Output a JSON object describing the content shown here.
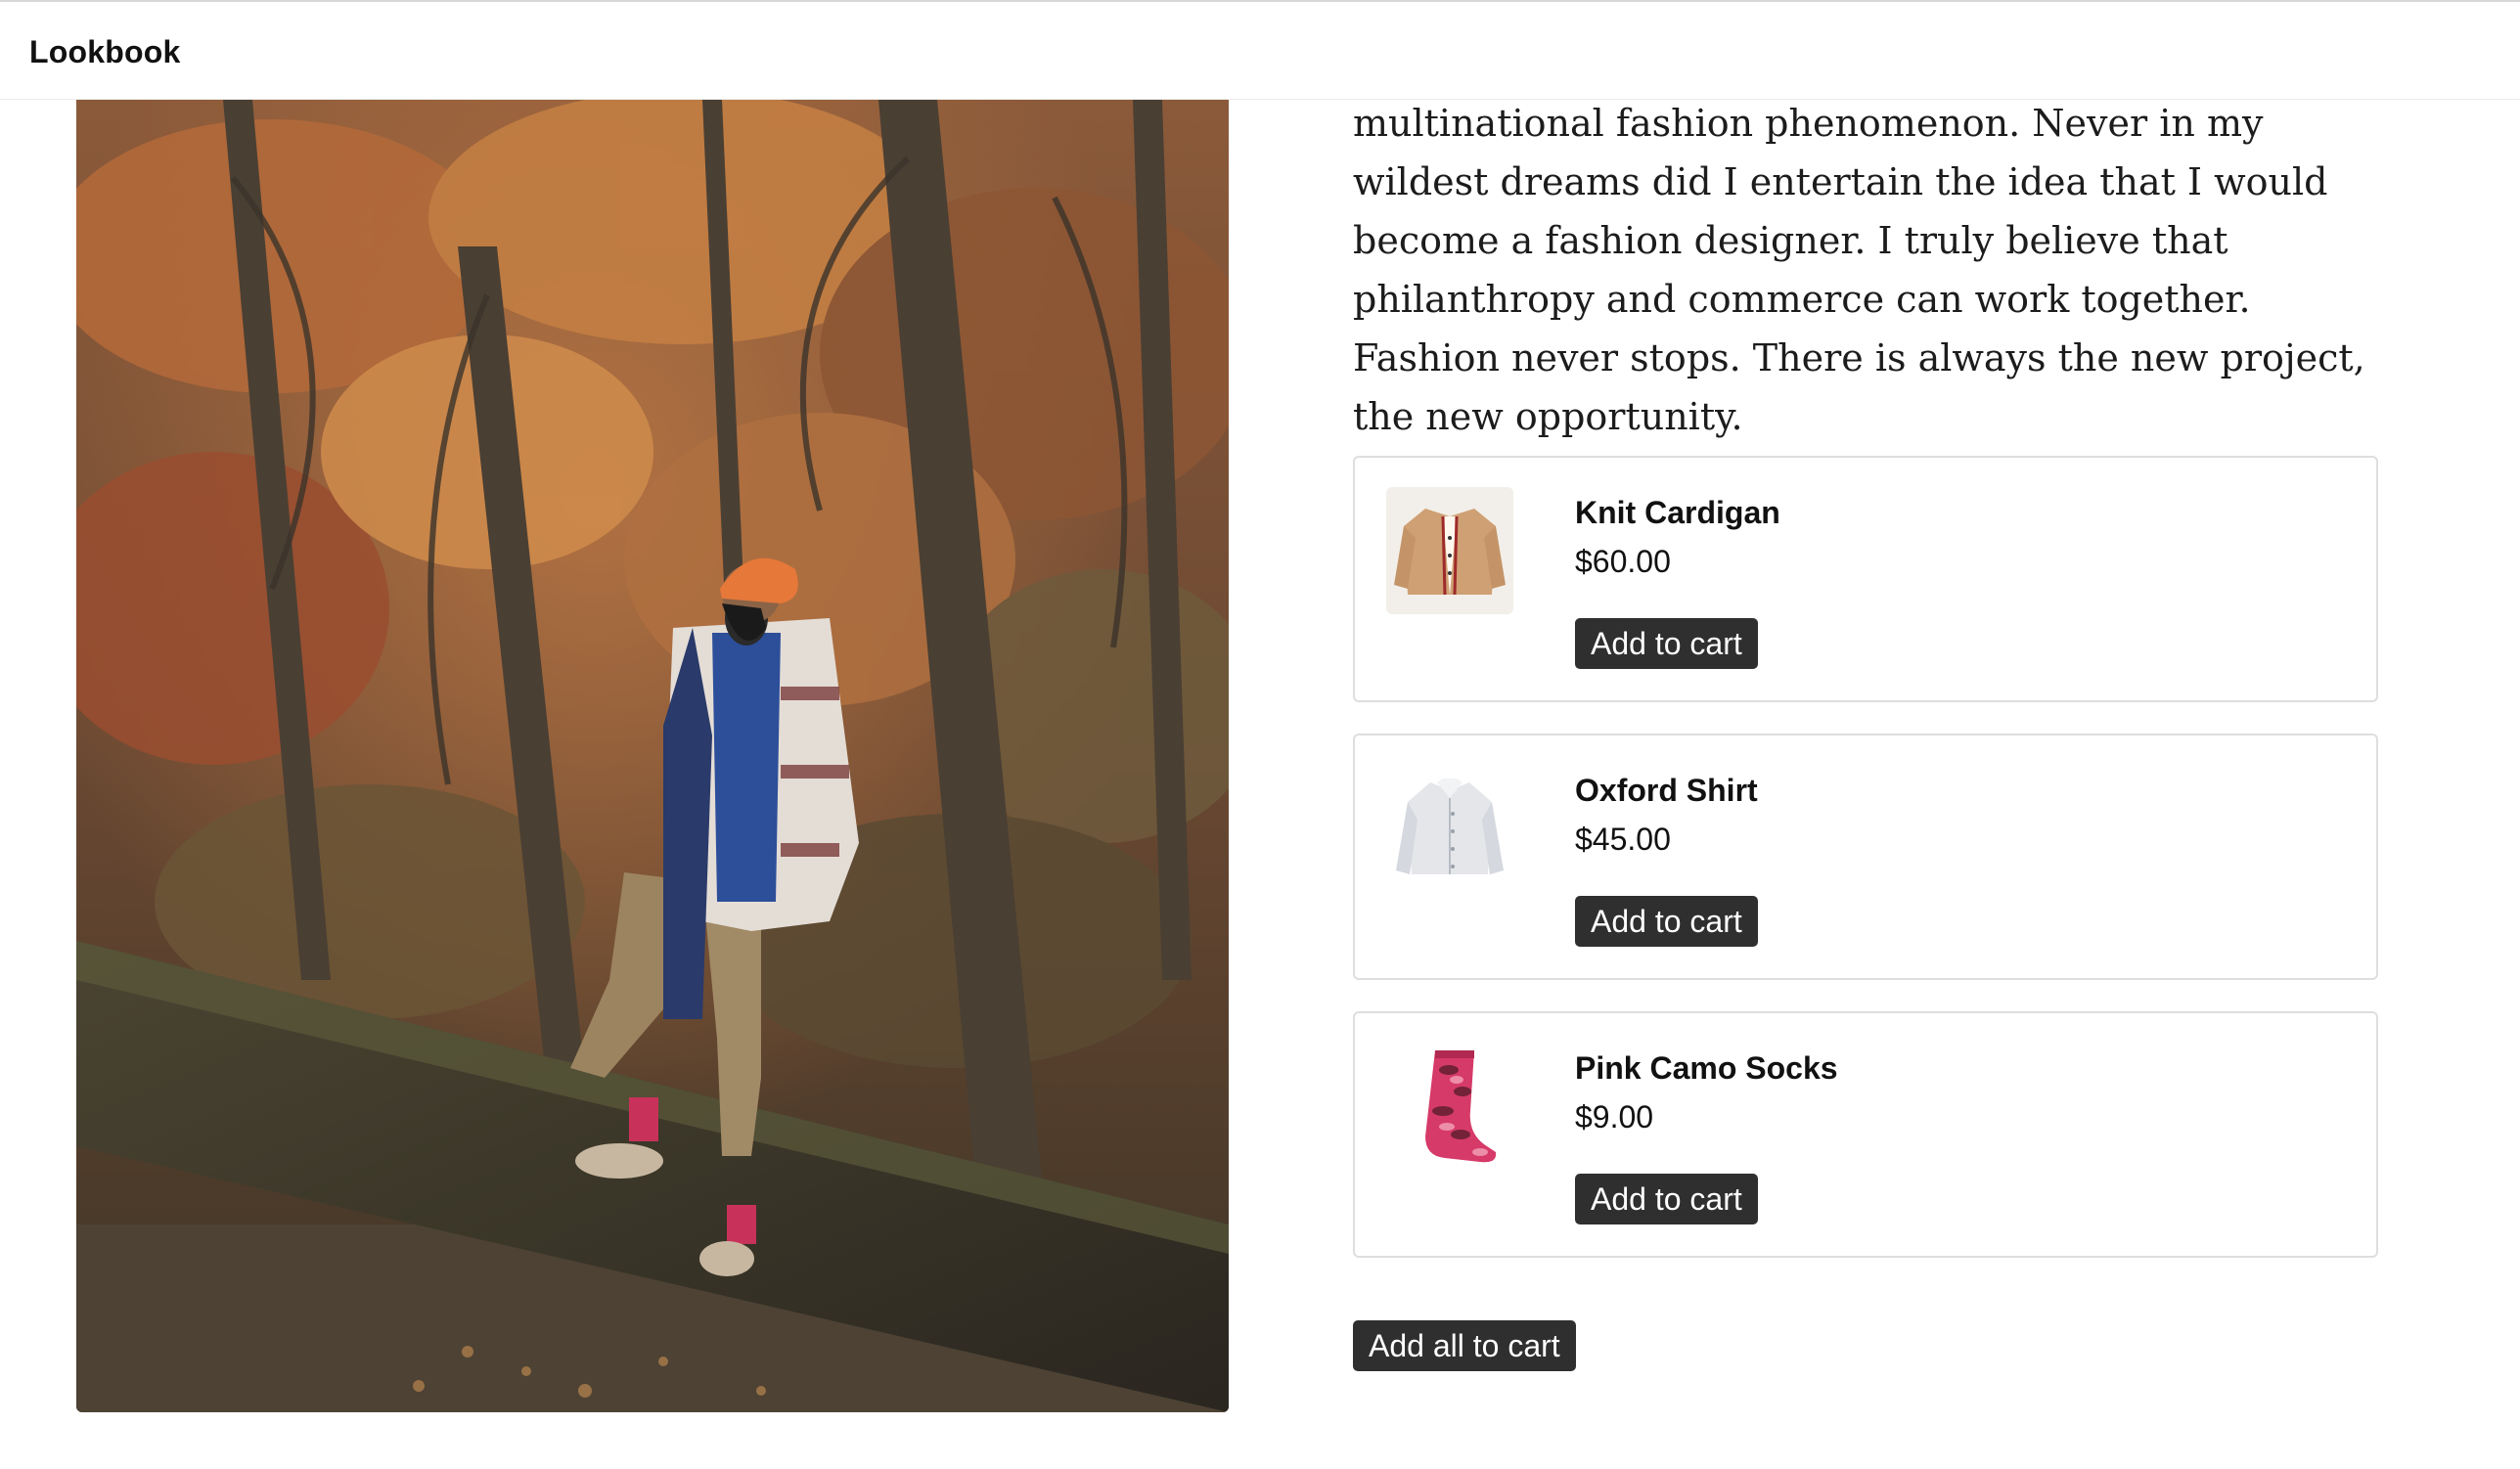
{
  "header": {
    "brand": "Lookbook"
  },
  "story": {
    "text": "multinational fashion phenomenon. Never in my wildest dreams did I entertain the idea that I would become a fashion designer. I truly believe that philanthropy and commerce can work together. Fashion never stops. There is always the new project, the new opportunity."
  },
  "products": [
    {
      "name": "Knit Cardigan",
      "price": "$60.00",
      "button": "Add to cart",
      "icon": "cardigan-thumbnail"
    },
    {
      "name": "Oxford Shirt",
      "price": "$45.00",
      "button": "Add to cart",
      "icon": "shirt-thumbnail"
    },
    {
      "name": "Pink Camo Socks",
      "price": "$9.00",
      "button": "Add to cart",
      "icon": "socks-thumbnail"
    }
  ],
  "actions": {
    "add_all": "Add all to cart"
  },
  "colors": {
    "button_bg": "#2f2f2f",
    "button_text": "#ffffff",
    "card_border": "#dedede"
  }
}
